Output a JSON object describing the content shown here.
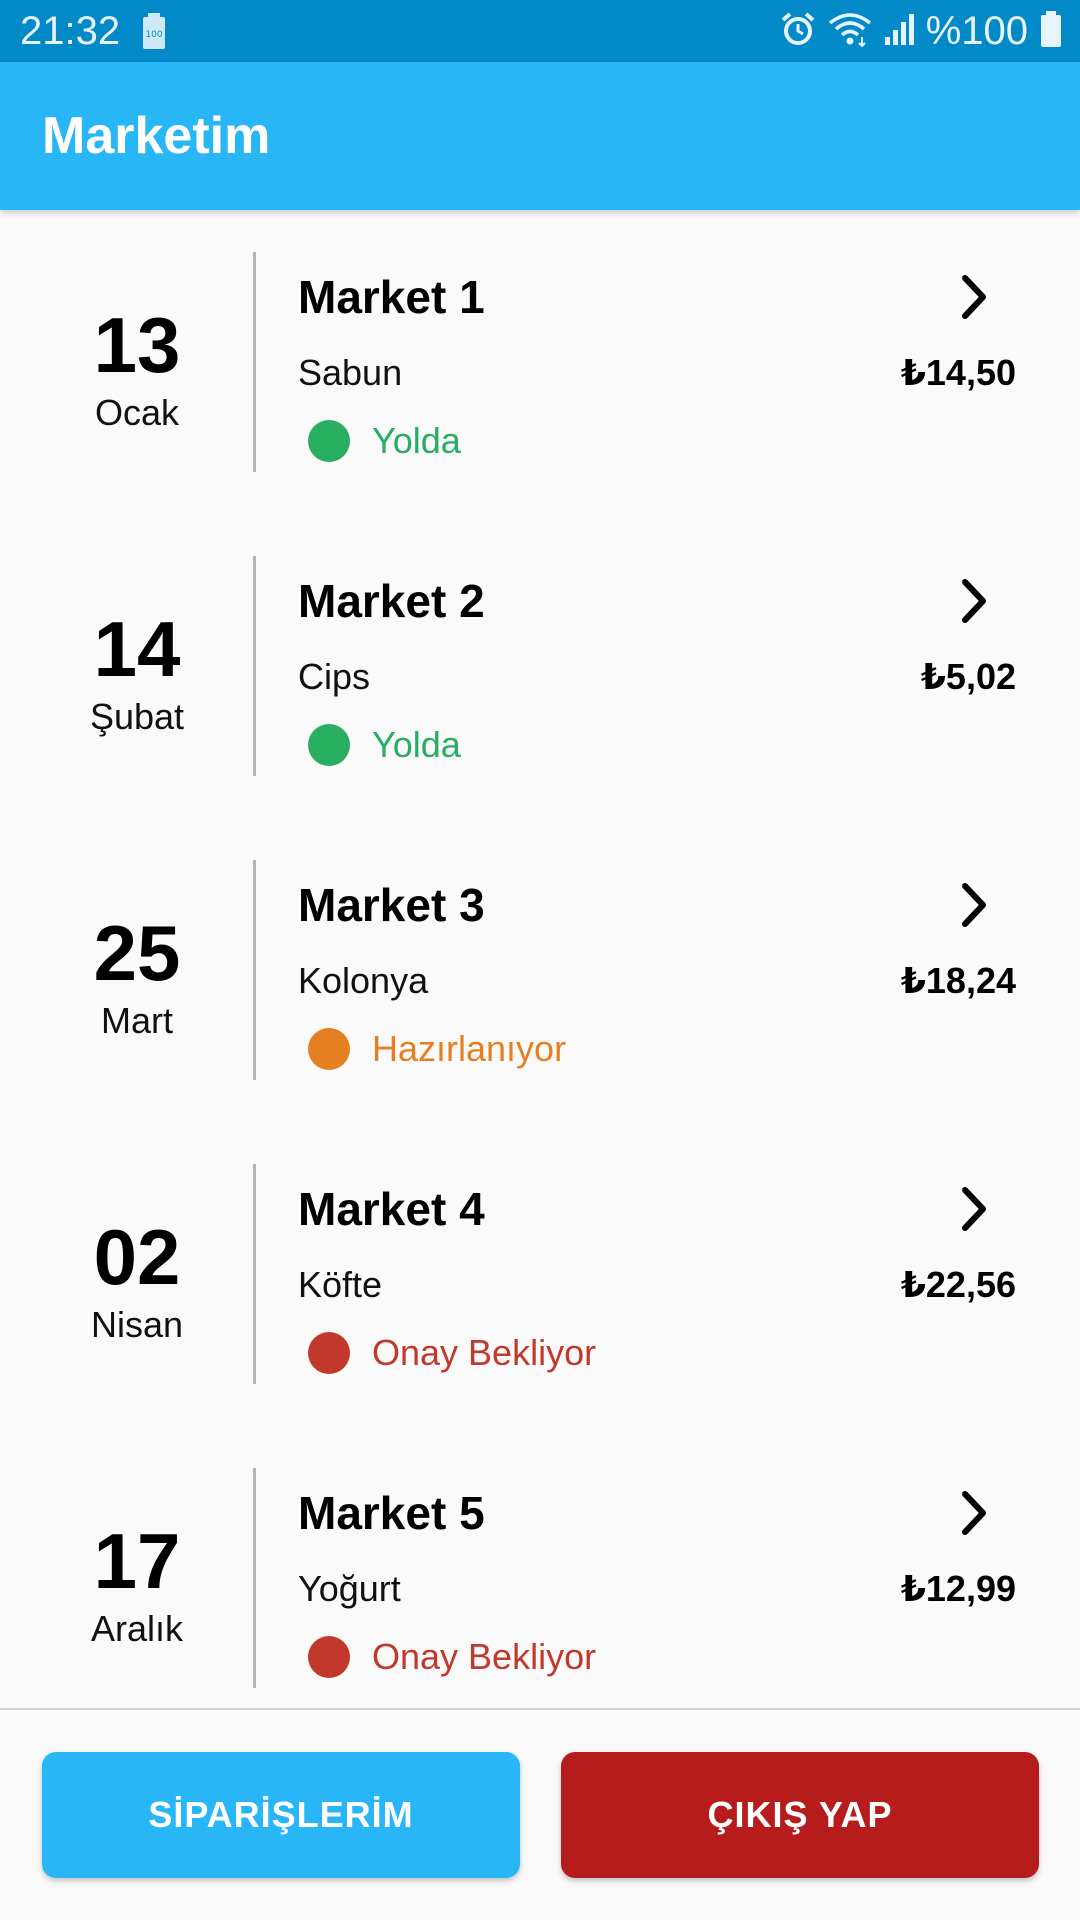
{
  "status_bar": {
    "time": "21:32",
    "battery_text": "%100",
    "icons": [
      "battery-saver-icon",
      "alarm-icon",
      "wifi-icon",
      "signal-icon",
      "battery-icon"
    ]
  },
  "app_bar": {
    "title": "Marketim"
  },
  "colors": {
    "status_bar_bg": "#0289c8",
    "app_bar_bg": "#29b6f6",
    "status_green": "#27ae60",
    "status_orange": "#e67e22",
    "status_red": "#c0392b",
    "logout_button": "#b71c1c"
  },
  "orders": [
    {
      "day": "13",
      "month": "Ocak",
      "market": "Market 1",
      "product": "Sabun",
      "price": "₺14,50",
      "status": "Yolda",
      "status_color": "#27ae60"
    },
    {
      "day": "14",
      "month": "Şubat",
      "market": "Market 2",
      "product": "Cips",
      "price": "₺5,02",
      "status": "Yolda",
      "status_color": "#27ae60"
    },
    {
      "day": "25",
      "month": "Mart",
      "market": "Market 3",
      "product": "Kolonya",
      "price": "₺18,24",
      "status": "Hazırlanıyor",
      "status_color": "#e67e22"
    },
    {
      "day": "02",
      "month": "Nisan",
      "market": "Market 4",
      "product": "Köfte",
      "price": "₺22,56",
      "status": "Onay Bekliyor",
      "status_color": "#c0392b"
    },
    {
      "day": "17",
      "month": "Aralık",
      "market": "Market 5",
      "product": "Yoğurt",
      "price": "₺12,99",
      "status": "Onay Bekliyor",
      "status_color": "#c0392b"
    }
  ],
  "buttons": {
    "orders_label": "SİPARİŞLERİM",
    "logout_label": "ÇIKIŞ YAP"
  }
}
